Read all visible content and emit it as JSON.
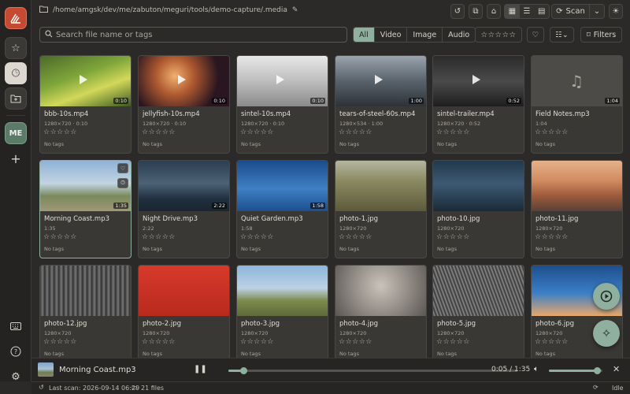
{
  "app": {
    "logo": "app-logo"
  },
  "rail": {
    "me_label": "ME"
  },
  "topbar": {
    "path": "/home/amgsk/dev/me/zabuton/meguri/tools/demo-capture/.media",
    "scan_label": "Scan"
  },
  "search": {
    "placeholder": "Search file name or tags",
    "value": ""
  },
  "filters": {
    "tabs": [
      "All",
      "Video",
      "Image",
      "Audio"
    ],
    "active": "All",
    "filters_label": "Filters",
    "rating_stars": "☆☆☆☆☆"
  },
  "cards": [
    {
      "name": "bbb-10s.mp4",
      "meta": "1280×720 · 0:10",
      "duration": "0:10",
      "stars": "☆☆☆☆☆",
      "tags": "No tags",
      "kind": "video"
    },
    {
      "name": "jellyfish-10s.mp4",
      "meta": "1280×720 · 0:10",
      "duration": "0:10",
      "stars": "☆☆☆☆☆",
      "tags": "No tags",
      "kind": "video"
    },
    {
      "name": "sintel-10s.mp4",
      "meta": "1280×720 · 0:10",
      "duration": "0:10",
      "stars": "☆☆☆☆☆",
      "tags": "No tags",
      "kind": "video"
    },
    {
      "name": "tears-of-steel-60s.mp4",
      "meta": "1280×534 · 1:00",
      "duration": "1:00",
      "stars": "☆☆☆☆☆",
      "tags": "No tags",
      "kind": "video"
    },
    {
      "name": "sintel-trailer.mp4",
      "meta": "1280×720 · 0:52",
      "duration": "0:52",
      "stars": "☆☆☆☆☆",
      "tags": "No tags",
      "kind": "video"
    },
    {
      "name": "Field Notes.mp3",
      "meta": "1:04",
      "duration": "1:04",
      "stars": "☆☆☆☆☆",
      "tags": "No tags",
      "kind": "audio"
    },
    {
      "name": "Morning Coast.mp3",
      "meta": "1:35",
      "duration": "1:35",
      "stars": "☆☆☆☆☆",
      "tags": "No tags",
      "kind": "audio"
    },
    {
      "name": "Night Drive.mp3",
      "meta": "2:22",
      "duration": "2:22",
      "stars": "☆☆☆☆☆",
      "tags": "No tags",
      "kind": "audio"
    },
    {
      "name": "Quiet Garden.mp3",
      "meta": "1:58",
      "duration": "1:58",
      "stars": "☆☆☆☆☆",
      "tags": "No tags",
      "kind": "audio"
    },
    {
      "name": "photo-1.jpg",
      "meta": "1280×720",
      "duration": "",
      "stars": "☆☆☆☆☆",
      "tags": "No tags",
      "kind": "image"
    },
    {
      "name": "photo-10.jpg",
      "meta": "1280×720",
      "duration": "",
      "stars": "☆☆☆☆☆",
      "tags": "No tags",
      "kind": "image"
    },
    {
      "name": "photo-11.jpg",
      "meta": "1280×720",
      "duration": "",
      "stars": "☆☆☆☆☆",
      "tags": "No tags",
      "kind": "image"
    },
    {
      "name": "photo-12.jpg",
      "meta": "1280×720",
      "duration": "",
      "stars": "☆☆☆☆☆",
      "tags": "No tags",
      "kind": "image"
    },
    {
      "name": "photo-2.jpg",
      "meta": "1280×720",
      "duration": "",
      "stars": "☆☆☆☆☆",
      "tags": "No tags",
      "kind": "image"
    },
    {
      "name": "photo-3.jpg",
      "meta": "1280×720",
      "duration": "",
      "stars": "☆☆☆☆☆",
      "tags": "No tags",
      "kind": "image"
    },
    {
      "name": "photo-4.jpg",
      "meta": "1280×720",
      "duration": "",
      "stars": "☆☆☆☆☆",
      "tags": "No tags",
      "kind": "image"
    },
    {
      "name": "photo-5.jpg",
      "meta": "1280×720",
      "duration": "",
      "stars": "☆☆☆☆☆",
      "tags": "No tags",
      "kind": "image"
    },
    {
      "name": "photo-6.jpg",
      "meta": "1280×720",
      "duration": "",
      "stars": "☆☆☆☆☆",
      "tags": "No tags",
      "kind": "image"
    }
  ],
  "player": {
    "title": "Morning Coast.mp3",
    "time": "0:05 / 1:35",
    "progress": 0.053,
    "volume": 0.9
  },
  "status": {
    "last_scan": "Last scan: 2026-09-14 06:29",
    "files": "21 files",
    "state": "Idle"
  },
  "colors": {
    "accent": "#8fb09e",
    "brand": "#c44a32",
    "background": "#2b2a28"
  }
}
